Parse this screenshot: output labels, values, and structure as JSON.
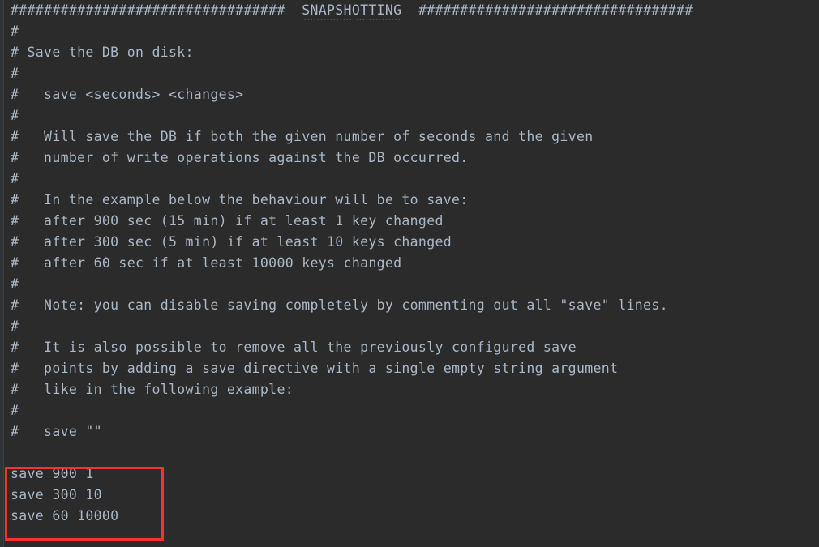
{
  "editor": {
    "background_color": "#2b2b2b",
    "text_color": "#a9b7c6",
    "gutter_color": "#313335",
    "annotation_color": "#f7312e",
    "squiggle_color": "#4f7a4f"
  },
  "header": {
    "hashes_left": "#################################",
    "title": "SNAPSHOTTING",
    "hashes_right": "#################################",
    "spacer_left": "  ",
    "spacer_right": "  "
  },
  "lines": [
    "#",
    "# Save the DB on disk:",
    "#",
    "#   save <seconds> <changes>",
    "#",
    "#   Will save the DB if both the given number of seconds and the given",
    "#   number of write operations against the DB occurred.",
    "#",
    "#   In the example below the behaviour will be to save:",
    "#   after 900 sec (15 min) if at least 1 key changed",
    "#   after 300 sec (5 min) if at least 10 keys changed",
    "#   after 60 sec if at least 10000 keys changed",
    "#",
    "#   Note: you can disable saving completely by commenting out all \"save\" lines.",
    "#",
    "#   It is also possible to remove all the previously configured save",
    "#   points by adding a save directive with a single empty string argument",
    "#   like in the following example:",
    "#",
    "#   save \"\""
  ],
  "active_config": {
    "lines": [
      "save 900 1",
      "save 300 10",
      "save 60 10000"
    ]
  }
}
